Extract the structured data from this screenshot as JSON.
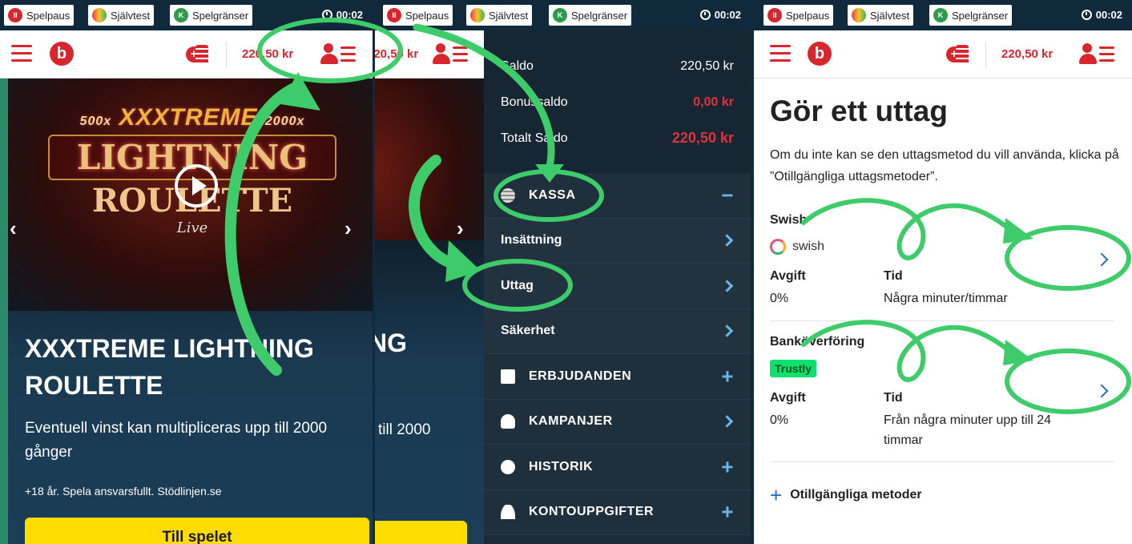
{
  "topbar": {
    "pause_label": "Spelpaus",
    "selftest_label": "Självtest",
    "limits_label": "Spelgränser",
    "time": "00:02"
  },
  "header": {
    "logo_text": "b",
    "balance": "220,50 kr"
  },
  "game": {
    "art_line1": "XXXTREME",
    "art_mult_left": "500x",
    "art_mult_right": "2000x",
    "art_line2": "LIGHTNING",
    "art_line3": "ROULETTE",
    "art_line4": "Live",
    "title": "XXXTREME LIGHTNING ROULETTE",
    "description": "Eventuell vinst kan multipliceras upp till 2000 gånger",
    "disclaimer": "+18 år. Spela ansvarsfullt. Stödlinjen.se",
    "cta": "Till spelet",
    "strip_title": "NG",
    "strip_desc": "till 2000"
  },
  "menu": {
    "saldo_label": "Saldo",
    "saldo_value": "220,50 kr",
    "bonus_label": "Bonussaldo",
    "bonus_value": "0,00 kr",
    "total_label": "Totalt Saldo",
    "total_value": "220,50 kr",
    "kassa": "KASSA",
    "insattning": "Insättning",
    "uttag": "Uttag",
    "sakerhet": "Säkerhet",
    "erbjudanden": "ERBJUDANDEN",
    "kampanjer": "KAMPANJER",
    "historik": "HISTORIK",
    "kontouppgifter": "KONTOUPPGIFTER"
  },
  "withdraw": {
    "title": "Gör ett uttag",
    "description": "Om du inte kan se den uttagsmetod du vill använda, klicka på ”Otillgängliga uttagsmetoder”.",
    "fee_label": "Avgift",
    "time_label": "Tid",
    "methods": [
      {
        "name": "Swish",
        "logo": "swish",
        "fee": "0%",
        "time": "Några minuter/timmar"
      },
      {
        "name": "Banköverföring",
        "logo": "Trustly",
        "fee": "0%",
        "time": "Från några minuter upp till 24 timmar"
      }
    ],
    "unavailable": "Otillgängliga metoder"
  },
  "colors": {
    "brand_red": "#d7262d",
    "annotation_green": "#3ecb6a",
    "cta_yellow": "#ffdd00"
  }
}
